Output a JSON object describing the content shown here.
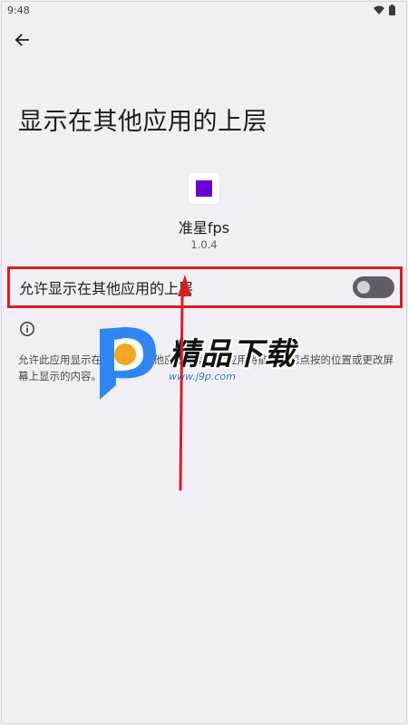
{
  "status_bar": {
    "time": "9:48",
    "icons": [
      "wifi-icon",
      "battery-icon"
    ]
  },
  "header": {
    "back_icon": "arrow-left-icon"
  },
  "page": {
    "title": "显示在其他应用的上层"
  },
  "app": {
    "name": "准星fps",
    "version": "1.0.4",
    "icon_color": "#6a00d8"
  },
  "setting": {
    "label": "允许显示在其他应用的上层",
    "enabled": false
  },
  "info": {
    "icon": "info-icon",
    "description": "允许此应用显示在您使用的其他应用上层。此应用将能得知您点按的位置或更改屏幕上显示的内容。"
  },
  "watermark": {
    "brand": "精品下载",
    "url": "www.j9p.com"
  },
  "colors": {
    "background": "#f1eff5",
    "highlight_border": "#d62020",
    "annotation_arrow": "#d62020",
    "switch_track": "#605d66"
  }
}
